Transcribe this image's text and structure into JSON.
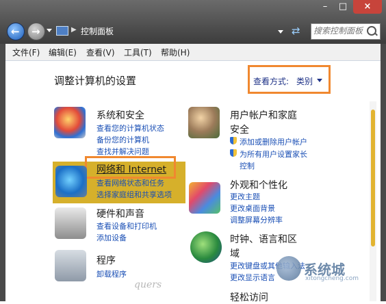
{
  "window": {
    "min_glyph": "–",
    "max_glyph": "□",
    "close_glyph": "×"
  },
  "address": {
    "location": "控制面板",
    "search_placeholder": "搜索控制面板"
  },
  "menu": {
    "items": [
      "文件(F)",
      "编辑(E)",
      "查看(V)",
      "工具(T)",
      "帮助(H)"
    ]
  },
  "page": {
    "heading": "调整计算机的设置",
    "view_by_label": "查看方式:",
    "view_by_value": "类别"
  },
  "categories": {
    "system_security": {
      "title": "系统和安全",
      "links": [
        "查看您的计算机状态",
        "备份您的计算机",
        "查找并解决问题"
      ]
    },
    "network_internet": {
      "title": "网络和 Internet",
      "links": [
        "查看网络状态和任务",
        "选择家庭组和共享选项"
      ]
    },
    "hardware_sound": {
      "title": "硬件和声音",
      "links": [
        "查看设备和打印机",
        "添加设备"
      ]
    },
    "programs": {
      "title": "程序",
      "links": [
        "卸载程序"
      ]
    },
    "user_accounts": {
      "title_line1": "用户帐户和家庭",
      "title_line2": "安全",
      "links": [
        "添加或删除用户帐户",
        "为所有用户设置家长",
        "控制"
      ]
    },
    "appearance": {
      "title": "外观和个性化",
      "links": [
        "更改主题",
        "更改桌面背景",
        "调整屏幕分辨率"
      ]
    },
    "clock_language": {
      "title_line1": "时钟、语言和区",
      "title_line2": "域",
      "links": [
        "更改键盘或其他输入法",
        "更改显示语言"
      ]
    },
    "ease_of_access": {
      "title": "轻松访问"
    }
  },
  "watermark": {
    "text": "系统城",
    "sub": "xitongcheng.com",
    "signature": "quers"
  },
  "colors": {
    "accent_orange": "#f0882f",
    "link_blue": "#1a4fb5",
    "highlight_gold": "#d6b02b"
  }
}
